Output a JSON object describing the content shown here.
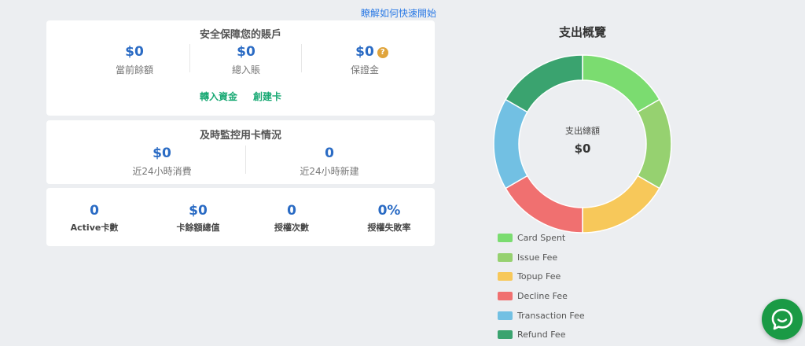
{
  "quick_start_link": "瞭解如何快速開始",
  "account": {
    "title": "安全保障您的賬戶",
    "stats": [
      {
        "value": "$0",
        "label": "當前餘額"
      },
      {
        "value": "$0",
        "label": "總入賬"
      },
      {
        "value": "$0",
        "label": "保證金"
      }
    ],
    "help_glyph": "?",
    "actions": {
      "transfer": "轉入資金",
      "create_card": "創建卡"
    }
  },
  "monitor": {
    "title": "及時監控用卡情況",
    "stats": [
      {
        "value": "$0",
        "label": "近24小時消費"
      },
      {
        "value": "0",
        "label": "近24小時新建"
      }
    ]
  },
  "summary": {
    "stats": [
      {
        "value": "0",
        "label": "Active卡數"
      },
      {
        "value": "$0",
        "label": "卡餘額總值"
      },
      {
        "value": "0",
        "label": "授權次數"
      },
      {
        "value": "0%",
        "label": "授權失敗率"
      }
    ]
  },
  "chart": {
    "title": "支出概覽",
    "center_label": "支出總額",
    "center_value": "$0"
  },
  "chart_data": {
    "type": "pie",
    "categories": [
      "Card Spent",
      "Issue Fee",
      "Topup Fee",
      "Decline Fee",
      "Transaction Fee",
      "Refund Fee"
    ],
    "values": [
      1,
      1,
      1,
      1,
      1,
      1
    ],
    "colors": [
      "#7bdc70",
      "#96d170",
      "#f7c85a",
      "#f07070",
      "#72c0e3",
      "#3aa36f"
    ],
    "legend_position": "bottom"
  }
}
